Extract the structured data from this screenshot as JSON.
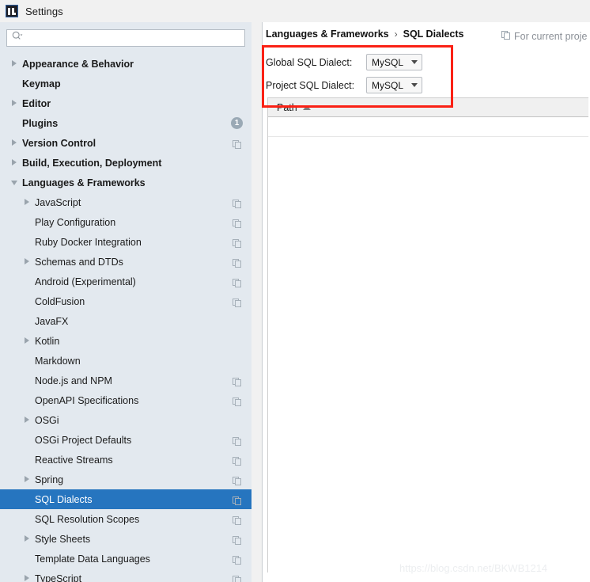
{
  "window": {
    "title": "Settings",
    "logo_icon": "intellij-idea-logo-icon"
  },
  "sidebar": {
    "search": {
      "value": "",
      "placeholder": "",
      "icon": "search-icon"
    },
    "items": [
      {
        "label": "Appearance & Behavior",
        "level": 0,
        "arrow": "right",
        "badge": null,
        "copy_icon": false,
        "selected": false
      },
      {
        "label": "Keymap",
        "level": 0,
        "arrow": "none",
        "badge": null,
        "copy_icon": false,
        "selected": false
      },
      {
        "label": "Editor",
        "level": 0,
        "arrow": "right",
        "badge": null,
        "copy_icon": false,
        "selected": false
      },
      {
        "label": "Plugins",
        "level": 0,
        "arrow": "none",
        "badge": "1",
        "copy_icon": false,
        "selected": false
      },
      {
        "label": "Version Control",
        "level": 0,
        "arrow": "right",
        "badge": null,
        "copy_icon": true,
        "selected": false
      },
      {
        "label": "Build, Execution, Deployment",
        "level": 0,
        "arrow": "right",
        "badge": null,
        "copy_icon": false,
        "selected": false
      },
      {
        "label": "Languages & Frameworks",
        "level": 0,
        "arrow": "down",
        "badge": null,
        "copy_icon": false,
        "selected": false
      },
      {
        "label": "JavaScript",
        "level": 1,
        "arrow": "right",
        "badge": null,
        "copy_icon": true,
        "selected": false
      },
      {
        "label": "Play Configuration",
        "level": 1,
        "arrow": "none",
        "badge": null,
        "copy_icon": true,
        "selected": false
      },
      {
        "label": "Ruby Docker Integration",
        "level": 1,
        "arrow": "none",
        "badge": null,
        "copy_icon": true,
        "selected": false
      },
      {
        "label": "Schemas and DTDs",
        "level": 1,
        "arrow": "right",
        "badge": null,
        "copy_icon": true,
        "selected": false
      },
      {
        "label": "Android (Experimental)",
        "level": 1,
        "arrow": "none",
        "badge": null,
        "copy_icon": true,
        "selected": false
      },
      {
        "label": "ColdFusion",
        "level": 1,
        "arrow": "none",
        "badge": null,
        "copy_icon": true,
        "selected": false
      },
      {
        "label": "JavaFX",
        "level": 1,
        "arrow": "none",
        "badge": null,
        "copy_icon": false,
        "selected": false
      },
      {
        "label": "Kotlin",
        "level": 1,
        "arrow": "right",
        "badge": null,
        "copy_icon": false,
        "selected": false
      },
      {
        "label": "Markdown",
        "level": 1,
        "arrow": "none",
        "badge": null,
        "copy_icon": false,
        "selected": false
      },
      {
        "label": "Node.js and NPM",
        "level": 1,
        "arrow": "none",
        "badge": null,
        "copy_icon": true,
        "selected": false
      },
      {
        "label": "OpenAPI Specifications",
        "level": 1,
        "arrow": "none",
        "badge": null,
        "copy_icon": true,
        "selected": false
      },
      {
        "label": "OSGi",
        "level": 1,
        "arrow": "right",
        "badge": null,
        "copy_icon": false,
        "selected": false
      },
      {
        "label": "OSGi Project Defaults",
        "level": 1,
        "arrow": "none",
        "badge": null,
        "copy_icon": true,
        "selected": false
      },
      {
        "label": "Reactive Streams",
        "level": 1,
        "arrow": "none",
        "badge": null,
        "copy_icon": true,
        "selected": false
      },
      {
        "label": "Spring",
        "level": 1,
        "arrow": "right",
        "badge": null,
        "copy_icon": true,
        "selected": false
      },
      {
        "label": "SQL Dialects",
        "level": 1,
        "arrow": "none",
        "badge": null,
        "copy_icon": true,
        "selected": true
      },
      {
        "label": "SQL Resolution Scopes",
        "level": 1,
        "arrow": "none",
        "badge": null,
        "copy_icon": true,
        "selected": false
      },
      {
        "label": "Style Sheets",
        "level": 1,
        "arrow": "right",
        "badge": null,
        "copy_icon": true,
        "selected": false
      },
      {
        "label": "Template Data Languages",
        "level": 1,
        "arrow": "none",
        "badge": null,
        "copy_icon": true,
        "selected": false
      },
      {
        "label": "TypeScript",
        "level": 1,
        "arrow": "right",
        "badge": null,
        "copy_icon": true,
        "selected": false
      }
    ],
    "selection_color": "#2675bf",
    "background_color": "#e3e9ef"
  },
  "main": {
    "breadcrumb": {
      "parent": "Languages & Frameworks",
      "separator": "›",
      "current": "SQL Dialects"
    },
    "for_current_project": {
      "label": "For current proje",
      "icon": "project-copy-icon"
    },
    "form": {
      "rows": [
        {
          "label": "Global SQL Dialect:",
          "value": "MySQL"
        },
        {
          "label": "Project SQL Dialect:",
          "value": "MySQL"
        }
      ]
    },
    "table": {
      "columns": [
        {
          "label": "Path",
          "sort": "asc"
        }
      ],
      "rows": []
    }
  },
  "annotation": {
    "shape": "rectangle",
    "color": "#fa2115"
  },
  "watermark": {
    "text": "https://blog.csdn.net/BKWB1214"
  }
}
